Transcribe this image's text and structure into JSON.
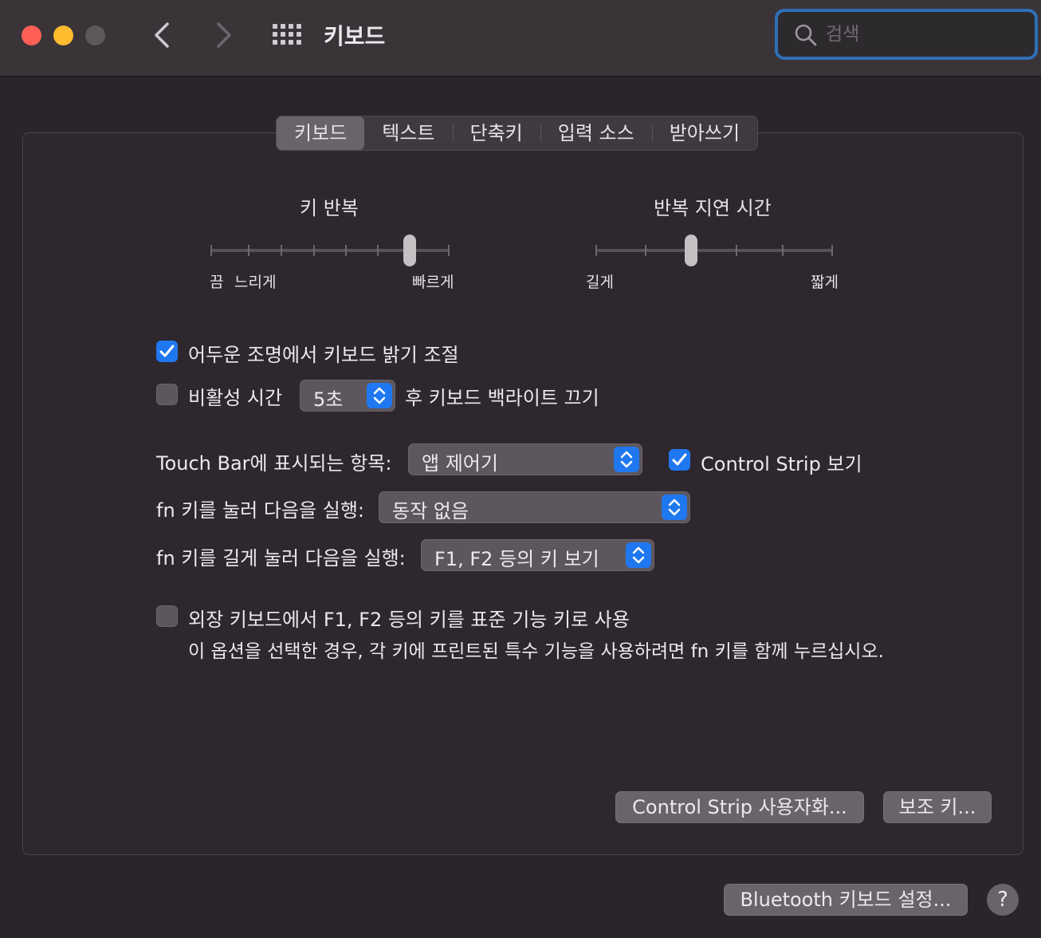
{
  "window": {
    "title": "키보드"
  },
  "search": {
    "placeholder": "검색"
  },
  "tabs": [
    {
      "label": "키보드",
      "active": true
    },
    {
      "label": "텍스트"
    },
    {
      "label": "단축키"
    },
    {
      "label": "입력 소스"
    },
    {
      "label": "받아쓰기"
    }
  ],
  "key_repeat": {
    "title": "키 반복",
    "label_off": "끔",
    "label_slow": "느리게",
    "label_fast": "빠르게",
    "position": 7,
    "steps": 8
  },
  "repeat_delay": {
    "title": "반복 지연 시간",
    "label_long": "길게",
    "label_short": "짧게",
    "position": 2,
    "steps": 6
  },
  "options": {
    "adjust_brightness": {
      "label": "어두운 조명에서 키보드 밝기 조절",
      "checked": true
    },
    "backlight_off": {
      "label_before": "비활성 시간",
      "value": "5초",
      "label_after": "후 키보드 백라이트 끄기",
      "checked": false
    },
    "touchbar": {
      "label": "Touch Bar에 표시되는 항목:",
      "value": "앱 제어기"
    },
    "control_strip": {
      "label": "Control Strip 보기",
      "checked": true
    },
    "fn_press": {
      "label": "fn 키를 눌러 다음을 실행:",
      "value": "동작 없음"
    },
    "fn_hold": {
      "label": "fn 키를 길게 눌러 다음을 실행:",
      "value": "F1, F2 등의 키 보기"
    },
    "standard_fn": {
      "label": "외장 키보드에서 F1, F2 등의 키를 표준 기능 키로 사용",
      "description": "이 옵션을 선택한 경우, 각 키에 프린트된 특수 기능을 사용하려면 fn 키를 함께 누르십시오.",
      "checked": false
    }
  },
  "buttons": {
    "customize_strip": "Control Strip 사용자화...",
    "modifier_keys": "보조 키...",
    "bluetooth": "Bluetooth 키보드 설정...",
    "help": "?"
  },
  "colors": {
    "accent": "#1f78f0",
    "search_focus": "#2f6fb6"
  }
}
